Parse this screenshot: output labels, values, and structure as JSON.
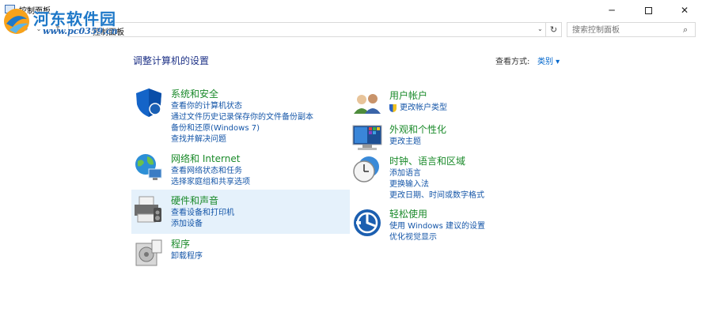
{
  "window": {
    "title": "控制面板"
  },
  "watermark": {
    "title": "河东软件园",
    "url": "www.pc0359.cn"
  },
  "nav": {
    "back": "←",
    "forward": "→",
    "recent": "⌄",
    "up": "↑",
    "address_crumb": "控制面板",
    "address_dropdown": "⌄",
    "refresh": "↻",
    "search_placeholder": "搜索控制面板",
    "search_icon": "⌕"
  },
  "main": {
    "heading": "调整计算机的设置",
    "view_by_label": "查看方式:",
    "view_by_value": "类别 ▾"
  },
  "categories": [
    {
      "title": "系统和安全",
      "icon": "shield-icon",
      "links": [
        "查看你的计算机状态",
        "通过文件历史记录保存你的文件备份副本",
        "备份和还原(Windows 7)",
        "查找并解决问题"
      ]
    },
    {
      "title": "网络和 Internet",
      "icon": "globe-network-icon",
      "links": [
        "查看网络状态和任务",
        "选择家庭组和共享选项"
      ]
    },
    {
      "title": "硬件和声音",
      "icon": "printer-icon",
      "links": [
        "查看设备和打印机",
        "添加设备"
      ]
    },
    {
      "title": "程序",
      "icon": "programs-icon",
      "links": [
        "卸载程序"
      ]
    },
    {
      "title": "用户帐户",
      "icon": "users-icon",
      "links": [
        "更改帐户类型"
      ]
    },
    {
      "title": "外观和个性化",
      "icon": "display-icon",
      "links": [
        "更改主题"
      ]
    },
    {
      "title": "时钟、语言和区域",
      "icon": "clock-globe-icon",
      "links": [
        "添加语言",
        "更换输入法",
        "更改日期、时间或数字格式"
      ]
    },
    {
      "title": "轻松使用",
      "icon": "ease-of-access-icon",
      "links": [
        "使用 Windows 建议的设置",
        "优化视觉显示"
      ]
    }
  ],
  "colors": {
    "category_title": "#1a8a2a",
    "link": "#1556a8",
    "heading": "#1e3287",
    "hover": "#e5f1fb"
  }
}
